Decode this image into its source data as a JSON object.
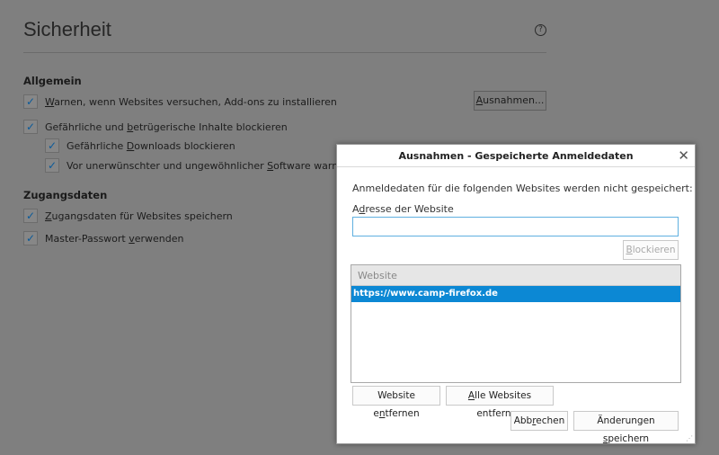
{
  "page": {
    "title": "Sicherheit",
    "help_icon": "question-circle-icon"
  },
  "general": {
    "heading": "Allgemein",
    "items": [
      {
        "pre": "",
        "key": "W",
        "post": "arnen, wenn Websites versuchen, Add-ons zu installieren",
        "checked": true
      },
      {
        "pre": "Gefährliche und ",
        "key": "b",
        "post": "etrügerische Inhalte blockieren",
        "checked": true
      },
      {
        "pre": "Gefährliche ",
        "key": "D",
        "post": "ownloads blockieren",
        "checked": true
      },
      {
        "pre": "Vor unerwünschter und ungewöhnlicher ",
        "key": "S",
        "post": "oftware warnen",
        "checked": true
      }
    ],
    "exceptions_button": {
      "pre": "",
      "key": "A",
      "post": "usnahmen..."
    }
  },
  "logins": {
    "heading": "Zugangsdaten",
    "items": [
      {
        "pre": "",
        "key": "Z",
        "post": "ugangsdaten für Websites speichern",
        "checked": true
      },
      {
        "pre": "Master-Passwort ",
        "key": "v",
        "post": "erwenden",
        "checked": true
      }
    ]
  },
  "dialog": {
    "title": "Ausnahmen - Gespeicherte Anmeldedaten",
    "description": "Anmeldedaten für die folgenden Websites werden nicht gespeichert:",
    "address_label": {
      "pre": "A",
      "key": "d",
      "post": "resse der Website"
    },
    "address_value": "",
    "block_button": {
      "pre": "",
      "key": "B",
      "post": "lockieren"
    },
    "table": {
      "column": "Website",
      "rows": [
        {
          "site": "https://www.camp-firefox.de",
          "selected": true
        }
      ]
    },
    "remove_button": {
      "pre": "Website e",
      "key": "n",
      "post": "tfernen"
    },
    "remove_all_button": {
      "pre": "",
      "key": "A",
      "post": "lle Websites entfernen"
    },
    "cancel_button": {
      "pre": "Abb",
      "key": "r",
      "post": "echen"
    },
    "save_button": {
      "pre": "Änderungen ",
      "key": "s",
      "post": "peichern"
    },
    "accent": "#0c88d4"
  }
}
